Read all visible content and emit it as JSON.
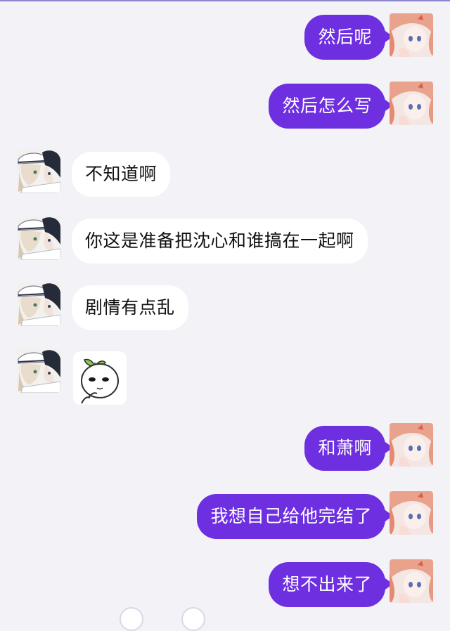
{
  "conversation": {
    "messages": [
      {
        "side": "outgoing",
        "text": "然后呢"
      },
      {
        "side": "outgoing",
        "text": "然后怎么写"
      },
      {
        "side": "incoming",
        "text": "不知道啊"
      },
      {
        "side": "incoming",
        "text": "你这是准备把沈心和谁搞在一起啊"
      },
      {
        "side": "incoming",
        "text": "剧情有点乱"
      },
      {
        "side": "incoming",
        "type": "sticker",
        "sticker": "sprout-face-sticker"
      },
      {
        "side": "outgoing",
        "text": "和萧啊"
      },
      {
        "side": "outgoing",
        "text": "我想自己给他完结了"
      },
      {
        "side": "outgoing",
        "text": "想不出来了"
      }
    ]
  },
  "colors": {
    "outgoing_bubble": "#6e2fe0",
    "incoming_bubble": "#ffffff",
    "background": "#f2f2f7"
  },
  "icons": {
    "self_avatar": "anime-girl-avatar",
    "other_avatar": "anime-couple-avatar"
  }
}
